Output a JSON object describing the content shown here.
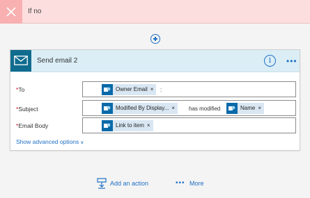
{
  "branch": {
    "title": "If no",
    "close_icon": "close-icon"
  },
  "card": {
    "title": "Send email 2",
    "more_label": "•••",
    "info_label": "i"
  },
  "fields": {
    "to": {
      "label": "To",
      "required_mark": "*",
      "token": "Owner Email",
      "trailing": ":"
    },
    "subject": {
      "label": "Subject",
      "required_mark": "*",
      "token1": "Modified By Display...",
      "middle": "has modified",
      "token2": "Name"
    },
    "body": {
      "label": "Email Body",
      "required_mark": "*",
      "token": "Link to item"
    }
  },
  "token_remove": "×",
  "advanced": {
    "label": "Show advanced options",
    "chevron": "∨"
  },
  "footer": {
    "add_action": "Add an action",
    "more": "More",
    "more_dots": "•••"
  },
  "colors": {
    "branch_bg": "#fcdede",
    "accent": "#1f6fc5",
    "mail_tile": "#0f6c8f",
    "token_bg": "#d9e7f3",
    "required": "#c8102e"
  }
}
